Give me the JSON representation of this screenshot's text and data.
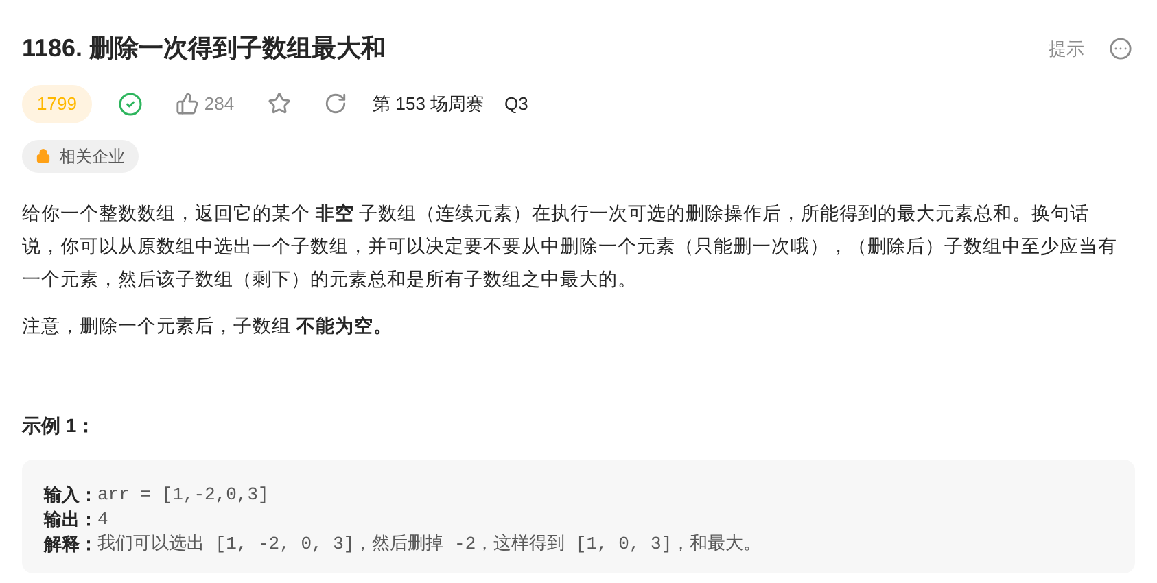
{
  "title": "1186. 删除一次得到子数组最大和",
  "header_actions": {
    "hint": "提示"
  },
  "meta": {
    "difficulty": "1799",
    "solved": true,
    "likes": "284",
    "contest": "第 153 场周赛",
    "question": "Q3"
  },
  "company_tag": "相关企业",
  "description": [
    "给你一个整数数组，返回它的某个 **非空** 子数组（连续元素）在执行一次可选的删除操作后，所能得到的最大元素总和。换句话说，你可以从原数组中选出一个子数组，并可以决定要不要从中删除一个元素（只能删一次哦），（删除后）子数组中至少应当有一个元素，然后该子数组（剩下）的元素总和是所有子数组之中最大的。",
    "注意，删除一个元素后，子数组 **不能为空。**"
  ],
  "example": {
    "heading": "示例 1：",
    "lines": [
      {
        "label": "输入：",
        "value": "arr = [1,-2,0,3]"
      },
      {
        "label": "输出：",
        "value": "4"
      },
      {
        "label": "解释：",
        "value": "我们可以选出 [1, -2, 0, 3]，然后删掉 -2，这样得到 [1, 0, 3]，和最大。"
      }
    ]
  }
}
